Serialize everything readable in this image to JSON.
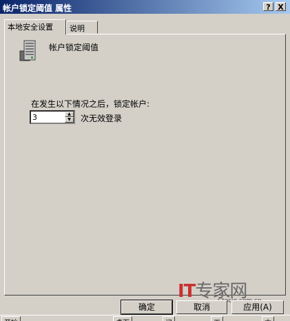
{
  "window": {
    "title": "帐户锁定阈值 属性",
    "help_button": "?",
    "close_button": "X"
  },
  "tabs": [
    {
      "label": "本地安全设置"
    },
    {
      "label": "说明"
    }
  ],
  "policy": {
    "name": "帐户锁定阈值",
    "description": "在发生以下情况之后，锁定帐户:",
    "threshold_value": "3",
    "unit_label": "次无效登录"
  },
  "buttons": {
    "ok": "确定",
    "cancel": "取消",
    "apply": "应用(A)"
  },
  "watermark": {
    "logo_it": "IT",
    "logo_text": "专家网",
    "site": "Ctocio.com.cn"
  },
  "taskbar": {
    "start": "开始",
    "items": [
      "桌面",
      "记",
      "工",
      "本"
    ]
  }
}
